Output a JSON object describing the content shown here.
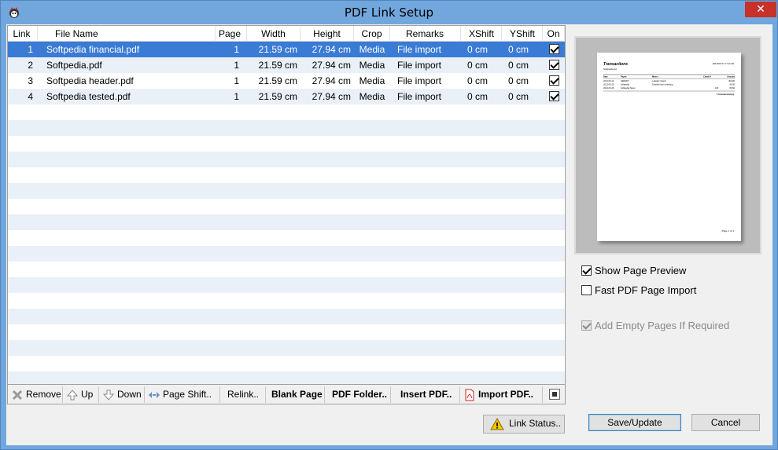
{
  "window": {
    "title": "PDF Link Setup",
    "close_glyph": "✕"
  },
  "grid": {
    "columns": [
      "Link",
      "File Name",
      "Page",
      "Width",
      "Height",
      "Crop",
      "Remarks",
      "XShift",
      "YShift",
      "On"
    ],
    "rows": [
      {
        "link": "1",
        "file": "Softpedia financial.pdf",
        "page": "1",
        "width": "21.59 cm",
        "height": "27.94 cm",
        "crop": "Media",
        "remarks": "File import",
        "xshift": "0 cm",
        "yshift": "0 cm",
        "on": true,
        "selected": true
      },
      {
        "link": "2",
        "file": "Softpedia.pdf",
        "page": "1",
        "width": "21.59 cm",
        "height": "27.94 cm",
        "crop": "Media",
        "remarks": "File import",
        "xshift": "0 cm",
        "yshift": "0 cm",
        "on": true,
        "selected": false
      },
      {
        "link": "3",
        "file": "Softpedia header.pdf",
        "page": "1",
        "width": "21.59 cm",
        "height": "27.94 cm",
        "crop": "Media",
        "remarks": "File import",
        "xshift": "0 cm",
        "yshift": "0 cm",
        "on": true,
        "selected": false
      },
      {
        "link": "4",
        "file": "Softpedia tested.pdf",
        "page": "1",
        "width": "21.59 cm",
        "height": "27.94 cm",
        "crop": "Media",
        "remarks": "File import",
        "xshift": "0 cm",
        "yshift": "0 cm",
        "on": true,
        "selected": false
      }
    ]
  },
  "toolbar": {
    "remove": "Remove",
    "up": "Up",
    "down": "Down",
    "page_shift": "Page Shift..",
    "relink": "Relink..",
    "blank_page": "Blank Page",
    "pdf_folder": "PDF Folder..",
    "insert_pdf": "Insert PDF..",
    "import_pdf": "Import PDF.."
  },
  "buttons": {
    "link_status": "Link Status..",
    "save": "Save/Update",
    "cancel": "Cancel"
  },
  "options": {
    "show_preview": {
      "label": "Show Page Preview",
      "checked": true
    },
    "fast_import": {
      "label": "Fast PDF Page Import",
      "checked": false
    },
    "add_empty": {
      "label": "Add Empty Pages If Required",
      "checked": true,
      "disabled": true
    }
  },
  "preview": {
    "doc_title": "Transactions",
    "doc_date": "2013/07/17 17:11:06",
    "doc_subtitle": "Softpedia ltd.",
    "table_headers": [
      "Date",
      "Payee",
      "Memo",
      "Check #",
      "Amount"
    ],
    "table_rows": [
      [
        "2013-05-13",
        "SEPERT",
        "Labuder Grauft",
        "",
        "400.00"
      ],
      [
        "2013-05-25",
        "Softpedia",
        "Transfer from checking",
        "",
        "45.05"
      ],
      [
        "2013-05-28",
        "Softpedia Tester",
        "",
        "163",
        "80.50"
      ]
    ],
    "total": "7 transaction(s)",
    "page_footer": "Page 1 of 1"
  },
  "colors": {
    "titlebar": "#71a7dd",
    "selection": "#3a7bd5",
    "alt_row": "#eaf0f8",
    "close": "#c7312a"
  },
  "icons": [
    "app-icon",
    "remove-icon",
    "up-arrow-icon",
    "down-arrow-icon",
    "page-shift-icon",
    "pdf-icon",
    "warning-icon",
    "stop-icon",
    "close-icon"
  ]
}
